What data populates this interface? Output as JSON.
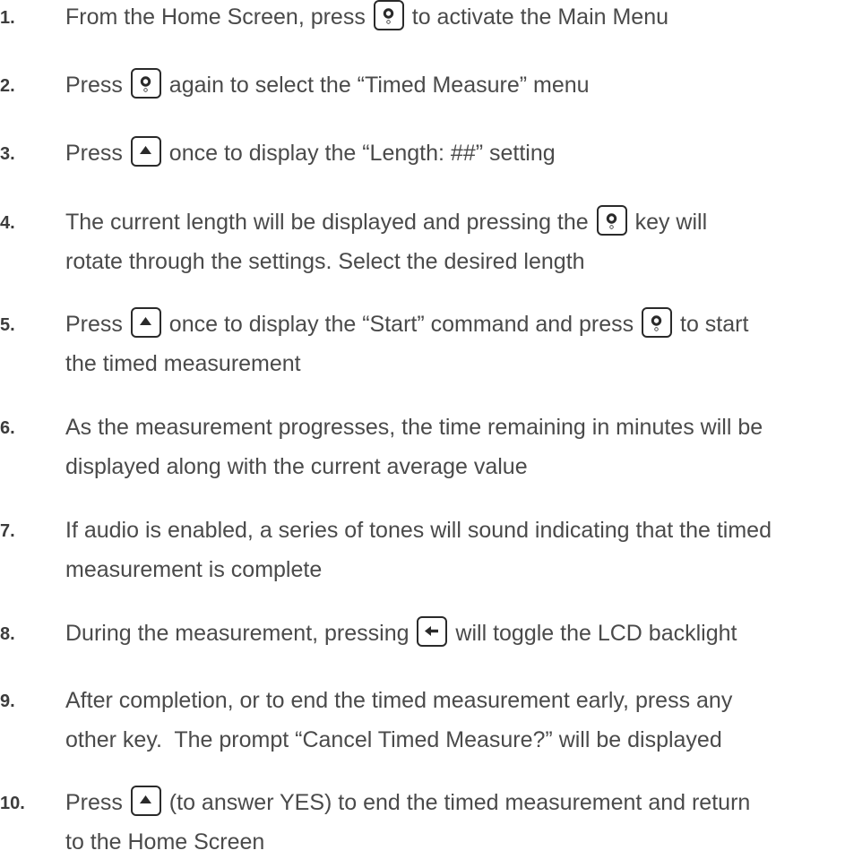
{
  "steps": [
    {
      "number": "1.",
      "lines": [
        {
          "parts": [
            {
              "text": "From the Home Screen, press "
            },
            {
              "key": "select-icon"
            },
            {
              "text": " to activate the Main Menu"
            }
          ]
        }
      ]
    },
    {
      "number": "2.",
      "lines": [
        {
          "parts": [
            {
              "text": "Press "
            },
            {
              "key": "select-icon"
            },
            {
              "text": " again to select the “Timed Measure” menu"
            }
          ]
        }
      ]
    },
    {
      "number": "3.",
      "lines": [
        {
          "parts": [
            {
              "text": "Press "
            },
            {
              "key": "up-arrow-icon"
            },
            {
              "text": " once to display the “Length: ##” setting"
            }
          ]
        }
      ]
    },
    {
      "number": "4.",
      "lines": [
        {
          "parts": [
            {
              "text": "The current length will be displayed and pressing the "
            },
            {
              "key": "select-icon"
            },
            {
              "text": " key will"
            }
          ]
        },
        {
          "parts": [
            {
              "text": "rotate through the settings. Select the desired length"
            }
          ]
        }
      ]
    },
    {
      "number": "5.",
      "lines": [
        {
          "parts": [
            {
              "text": "Press "
            },
            {
              "key": "up-arrow-icon"
            },
            {
              "text": " once to display the “Start” command and press "
            },
            {
              "key": "select-icon"
            },
            {
              "text": " to start"
            }
          ]
        },
        {
          "parts": [
            {
              "text": "the timed measurement"
            }
          ]
        }
      ]
    },
    {
      "number": "6.",
      "lines": [
        {
          "parts": [
            {
              "text": "As the measurement progresses, the time remaining in minutes will be"
            }
          ]
        },
        {
          "parts": [
            {
              "text": "displayed along with the current average value"
            }
          ]
        }
      ]
    },
    {
      "number": "7.",
      "lines": [
        {
          "parts": [
            {
              "text": "If audio is enabled, a series of tones will sound indicating that the timed"
            }
          ]
        },
        {
          "parts": [
            {
              "text": "measurement is complete"
            }
          ]
        }
      ]
    },
    {
      "number": "8.",
      "lines": [
        {
          "parts": [
            {
              "text": "During the measurement, pressing "
            },
            {
              "key": "left-arrow-icon"
            },
            {
              "text": " will toggle the LCD backlight"
            }
          ]
        }
      ]
    },
    {
      "number": "9.",
      "lines": [
        {
          "parts": [
            {
              "text": "After completion, or to end the timed measurement early, press any"
            }
          ]
        },
        {
          "parts": [
            {
              "text": "other key.  The prompt “Cancel Timed Measure?” will be displayed"
            }
          ]
        }
      ]
    },
    {
      "number": "10.",
      "lines": [
        {
          "parts": [
            {
              "text": "Press "
            },
            {
              "key": "up-arrow-icon"
            },
            {
              "text": " (to answer YES) to end the timed measurement and return"
            }
          ]
        },
        {
          "parts": [
            {
              "text": "to the Home Screen"
            }
          ]
        }
      ]
    }
  ]
}
